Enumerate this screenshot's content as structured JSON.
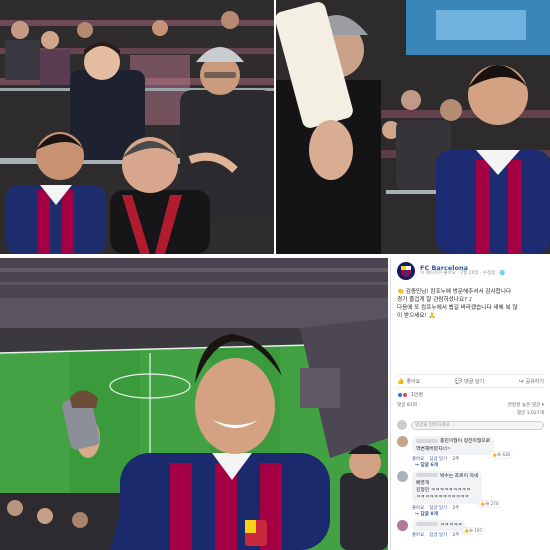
{
  "post": {
    "page_name": "FC Barcelona",
    "meta": "이 페이지가 좋아요 · 2월 26일 · 수정됨 · ",
    "body_lines": [
      "👏 김종민님! 캄프누에 방문해주셔서 감사합니다",
      "경기 즐겁게 잘 관람하셨나요? ♪",
      "다음에 또 캄프누에서 뵙길 바라겠습니다 새해 복 많",
      "이 받으세요! 🙏"
    ]
  },
  "actions": {
    "like": "좋아요",
    "comment": "댓글 달기",
    "share": "공유하기"
  },
  "reactions": {
    "count": "1만명",
    "comments_count": "댓글 81회",
    "sort": "관련성 높은 댓글 ▾",
    "shares": "댓글 1,027개"
  },
  "comment_input": {
    "placeholder": "댓글을 입력하세요..."
  },
  "comments": [
    {
      "line1": "종민이형이 정전이형으로",
      "line2": "역변해버렸자너~",
      "reaction": "636",
      "actions": [
        "좋아요",
        "답글 달기",
        "2주"
      ],
      "reply": "↪ 답글 6개"
    },
    {
      "line1": "박수는 흐르이 자네",
      "line2": "배영개",
      "line3": "김정민 ㅋㅋㅋㅋㅋㅋㅋㅋㅋ",
      "line4": "ㅋㅋㅋㅋㅋㅋㅋㅋㅋㅋㅋㅋ",
      "reaction": "274",
      "actions": [
        "좋아요",
        "답글 달기",
        "2주"
      ],
      "reply": "↪ 답글 8개"
    },
    {
      "line1": "ㅋㅋㅋㅋㅋ",
      "reaction": "197",
      "actions": [
        "좋아요",
        "답글 달기",
        "2주"
      ]
    }
  ],
  "colors": {
    "barca_blue": "#004d98",
    "barca_red": "#a50044",
    "pitch_green": "#3a9a3c",
    "fb_link": "#365899"
  }
}
